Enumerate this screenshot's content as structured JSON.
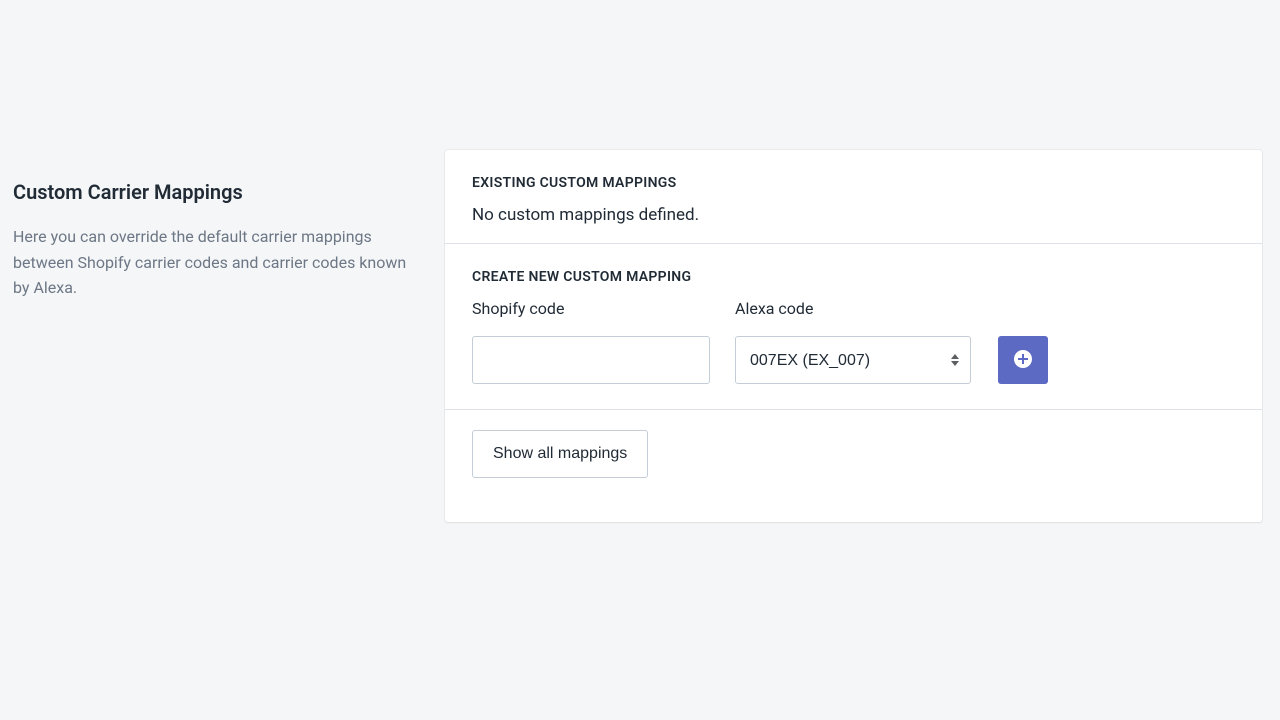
{
  "sidebar": {
    "title": "Custom Carrier Mappings",
    "description": "Here you can override the default carrier mappings between Shopify carrier codes and carrier codes known by Alexa."
  },
  "existing": {
    "heading": "EXISTING CUSTOM MAPPINGS",
    "empty": "No custom mappings defined."
  },
  "create": {
    "heading": "CREATE NEW CUSTOM MAPPING",
    "shopify_label": "Shopify code",
    "alexa_label": "Alexa code",
    "shopify_value": "",
    "alexa_selected": "007EX (EX_007)"
  },
  "footer": {
    "show_all_label": "Show all mappings"
  }
}
